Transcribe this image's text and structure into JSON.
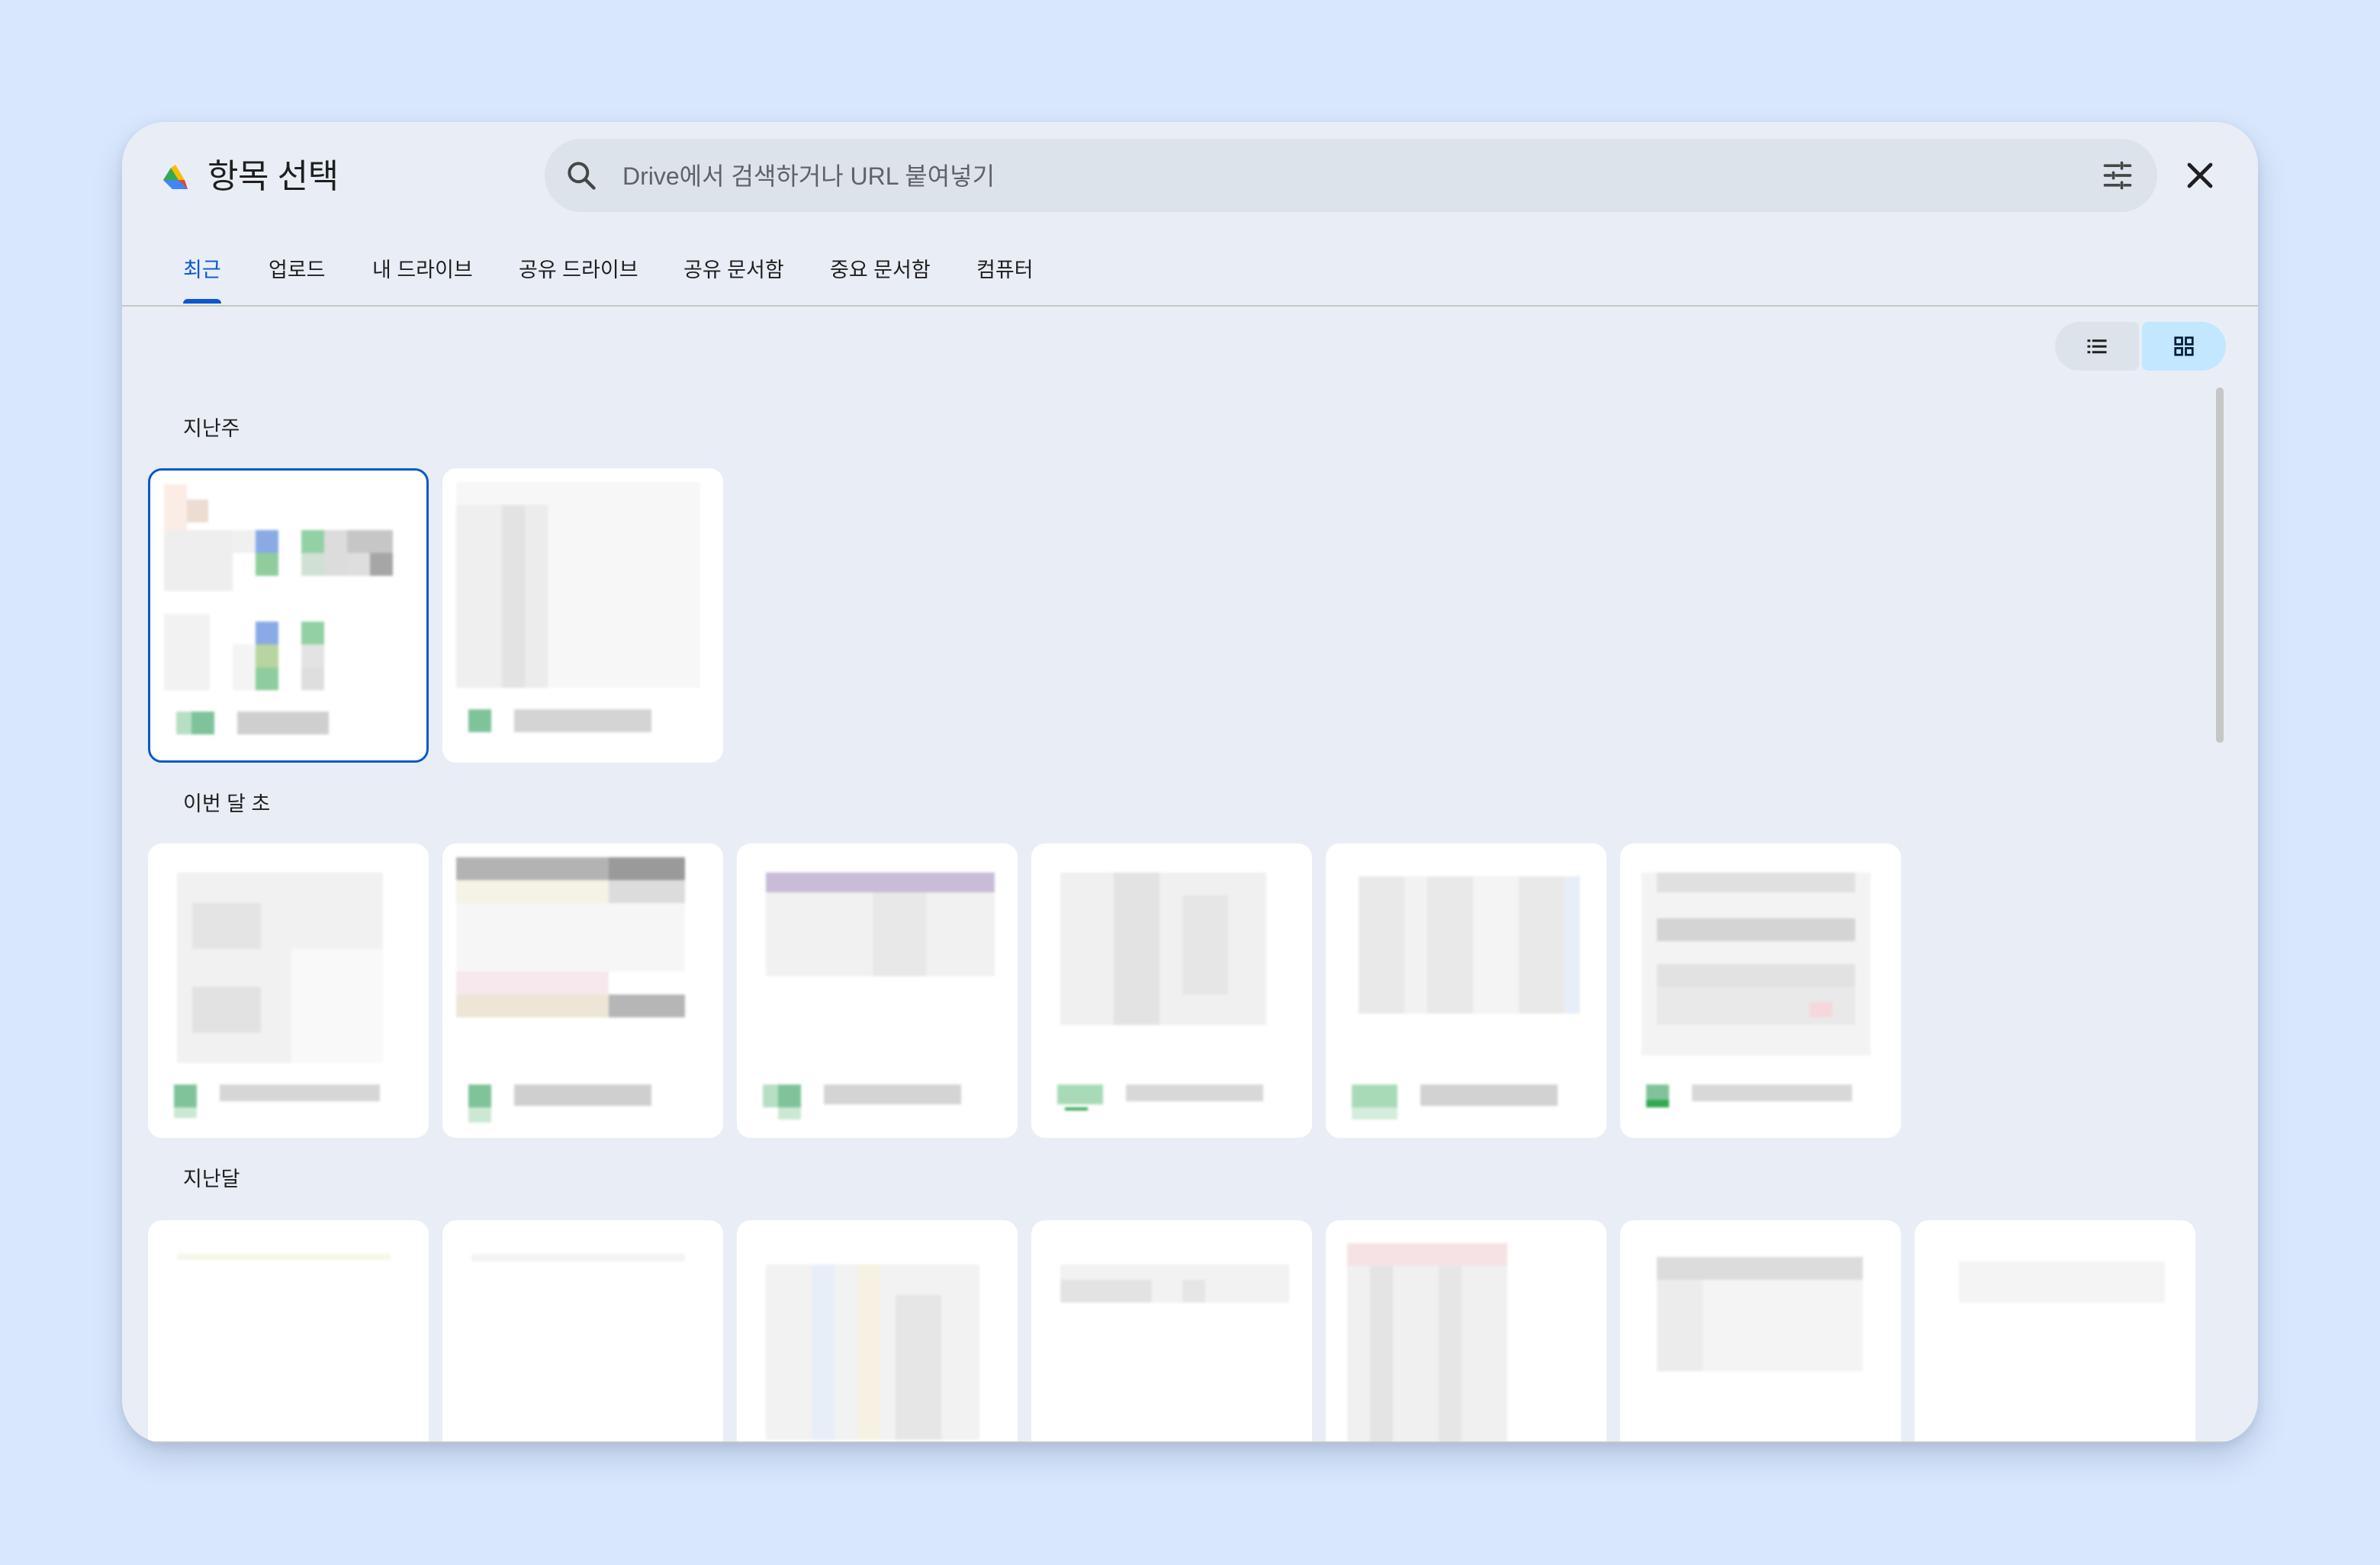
{
  "dialog": {
    "title": "항목 선택",
    "logo_icon": "google-drive-logo",
    "search": {
      "placeholder": "Drive에서 검색하거나 URL 붙여넣기",
      "value": "",
      "icon": "search-icon",
      "filter_icon": "tune-icon"
    },
    "close_icon": "close-icon"
  },
  "tabs": [
    {
      "label": "최근",
      "active": true
    },
    {
      "label": "업로드",
      "active": false
    },
    {
      "label": "내 드라이브",
      "active": false
    },
    {
      "label": "공유 드라이브",
      "active": false
    },
    {
      "label": "공유 문서함",
      "active": false
    },
    {
      "label": "중요 문서함",
      "active": false
    },
    {
      "label": "컴퓨터",
      "active": false
    }
  ],
  "view_toggle": {
    "selected": "grid",
    "options": [
      "list",
      "grid"
    ]
  },
  "sections": [
    {
      "label": "지난주",
      "card_count": 2
    },
    {
      "label": "이번 달 초",
      "card_count": 6
    },
    {
      "label": "지난달",
      "card_count": 7
    }
  ],
  "colors": {
    "accent": "#0b57d0",
    "background": "#d8e7fd",
    "dialog": "#e9eef6",
    "search": "#dde3ea",
    "toggle_selected": "#c2e7ff",
    "sheets_green": "#7fc39a"
  }
}
